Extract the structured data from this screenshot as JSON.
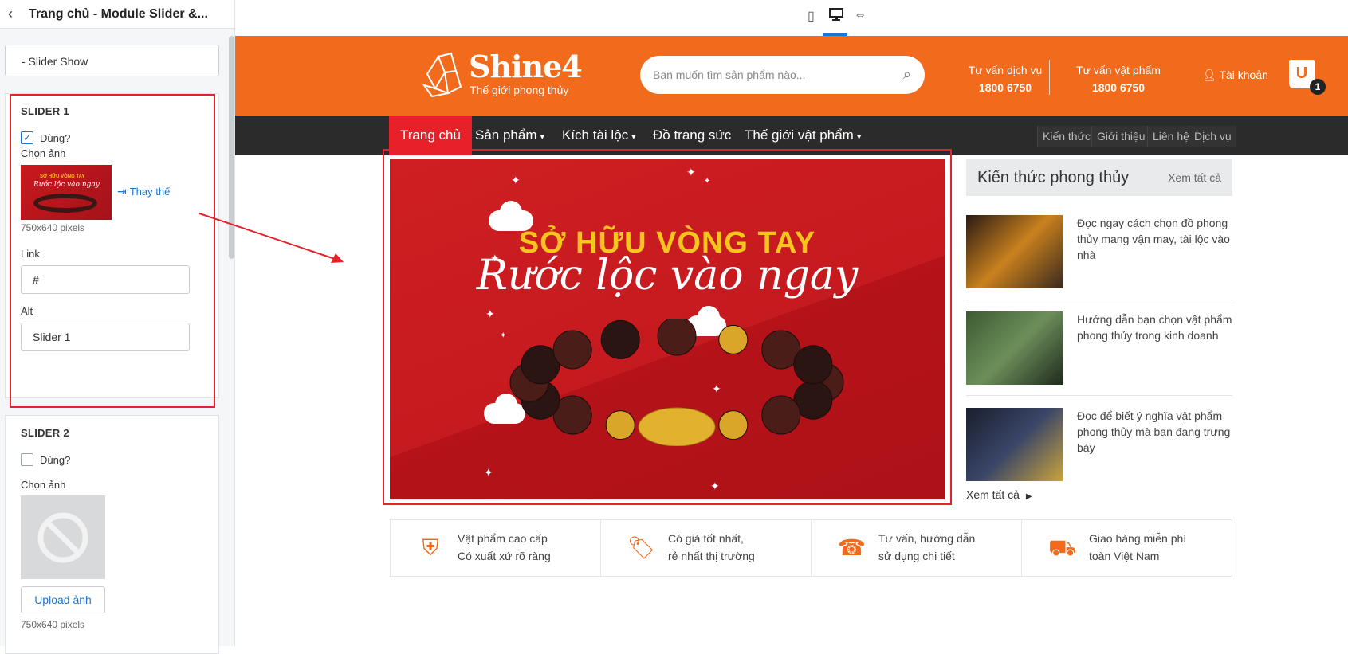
{
  "panel": {
    "title": "Trang chủ - Module Slider &...",
    "select_value": "- Slider Show",
    "slider1": {
      "title": "SLIDER 1",
      "use_label": "Dùng?",
      "use_checked": true,
      "image_label": "Chọn ảnh",
      "thumb_line1": "SỞ HỮU VÒNG TAY",
      "thumb_line2": "Rước lộc vào ngay",
      "replace_label": "Thay thế",
      "size_hint": "750x640 pixels",
      "link_label": "Link",
      "link_value": "#",
      "alt_label": "Alt",
      "alt_value": "Slider 1"
    },
    "slider2": {
      "title": "SLIDER 2",
      "use_label": "Dùng?",
      "use_checked": false,
      "image_label": "Chọn ảnh",
      "upload_label": "Upload ảnh",
      "size_hint": "750x640 pixels"
    }
  },
  "toolbar": {
    "devices": [
      "mobile-icon",
      "desktop-icon",
      "fullwidth-icon"
    ],
    "active": "desktop"
  },
  "site": {
    "logo_name": "Shine4",
    "logo_tag": "Thế giới phong thủy",
    "search_placeholder": "Bạn muốn tìm sản phẩm nào...",
    "hotline1_label": "Tư vấn dịch vụ",
    "hotline1_number": "1800 6750",
    "hotline2_label": "Tư vấn vật phẩm",
    "hotline2_number": "1800 6750",
    "account_label": "Tài khoản",
    "cart_letter": "U",
    "cart_count": "1",
    "nav": [
      {
        "label": "Trang chủ",
        "active": true
      },
      {
        "label": "Sản phẩm",
        "caret": true
      },
      {
        "label": "Kích tài lộc",
        "caret": true
      },
      {
        "label": "Đồ trang sức"
      },
      {
        "label": "Thế giới vật phẩm",
        "caret": true
      }
    ],
    "nav_small": [
      "Kiến thức",
      "Giới thiệu",
      "Liên hệ",
      "Dịch vụ"
    ],
    "banner": {
      "headline": "SỞ HỮU VÒNG TAY",
      "script": "Rước lộc vào ngay"
    },
    "news": {
      "title": "Kiến thức phong thủy",
      "see_all": "Xem tất cả",
      "items": [
        {
          "text": "Đọc ngay cách chọn đồ phong thủy mang vận may, tài lộc vào nhà"
        },
        {
          "text": "Hướng dẫn bạn chọn vật phẩm phong thủy trong kinh doanh"
        },
        {
          "text": "Đọc để biết ý nghĩa vật phẩm phong thủy mà bạn đang trưng bày"
        }
      ],
      "more": "Xem tất cả"
    },
    "features": [
      {
        "icon": "shield-check-icon",
        "line1": "Vật phẩm cao cấp",
        "line2": "Có xuất xứ rõ ràng"
      },
      {
        "icon": "price-tag-icon",
        "line1": "Có giá tốt nhất,",
        "line2": "rẻ nhất thị trường"
      },
      {
        "icon": "headset-icon",
        "line1": "Tư vấn, hướng dẫn",
        "line2": "sử dụng chi tiết"
      },
      {
        "icon": "delivery-truck-icon",
        "line1": "Giao hàng miễn phí",
        "line2": "toàn Việt Nam"
      }
    ]
  },
  "colors": {
    "brand_orange": "#f26a1b",
    "nav_dark": "#2b2b2b",
    "accent_red": "#e8202a",
    "link_blue": "#1976d2",
    "banner_red": "#c51a1f",
    "banner_yellow": "#f7c51e"
  }
}
